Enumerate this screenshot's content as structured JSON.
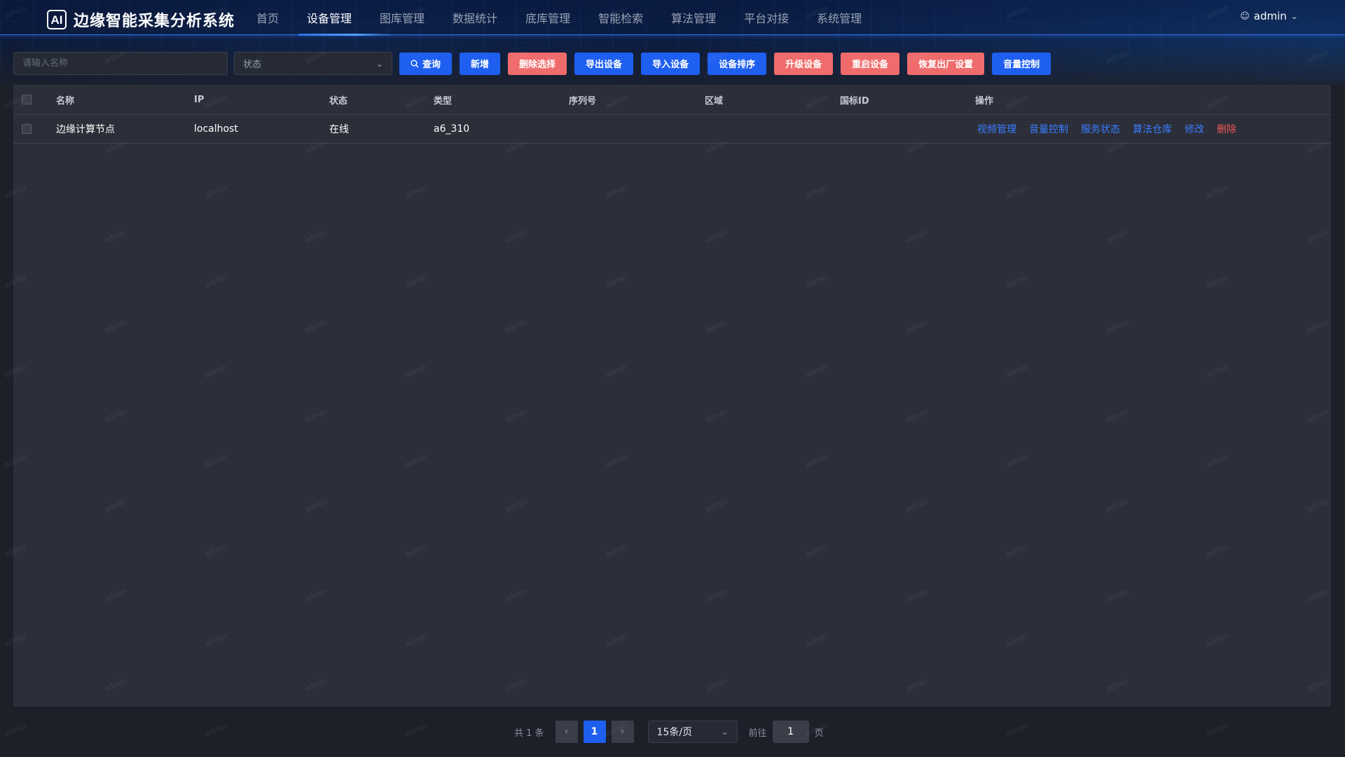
{
  "app": {
    "logo_text": "AI",
    "title": "边缘智能采集分析系统"
  },
  "nav": {
    "items": [
      {
        "label": "首页",
        "active": false
      },
      {
        "label": "设备管理",
        "active": true
      },
      {
        "label": "图库管理",
        "active": false
      },
      {
        "label": "数据统计",
        "active": false
      },
      {
        "label": "底库管理",
        "active": false
      },
      {
        "label": "智能检索",
        "active": false
      },
      {
        "label": "算法管理",
        "active": false
      },
      {
        "label": "平台对接",
        "active": false
      },
      {
        "label": "系统管理",
        "active": false
      }
    ]
  },
  "user": {
    "name": "admin",
    "icon": "user-icon"
  },
  "toolbar": {
    "search_placeholder": "请输入名称",
    "search_value": "",
    "status_select_placeholder": "状态",
    "buttons": {
      "query": "查询",
      "add": "新增",
      "delete_selected": "删除选择",
      "export": "导出设备",
      "import": "导入设备",
      "sort": "设备排序",
      "upgrade": "升级设备",
      "restart": "重启设备",
      "factory_reset": "恢复出厂设置",
      "volume": "音量控制"
    }
  },
  "table": {
    "columns": {
      "name": "名称",
      "ip": "IP",
      "status": "状态",
      "type": "类型",
      "serial": "序列号",
      "region": "区域",
      "gb_id": "国标ID",
      "ops": "操作"
    },
    "rows": [
      {
        "name": "边缘计算节点",
        "ip": "localhost",
        "status": "在线",
        "type": "a6_310",
        "serial": "",
        "region": "",
        "gb_id": "",
        "ops": {
          "video": "视频管理",
          "volume": "音量控制",
          "service": "服务状态",
          "algorithm": "算法仓库",
          "edit": "修改",
          "delete": "删除"
        }
      }
    ]
  },
  "pagination": {
    "total_text": "共 1 条",
    "current_page": "1",
    "page_size": "15条/页",
    "goto_prefix": "前往",
    "goto_value": "1",
    "goto_suffix": "页"
  },
  "watermark_text": "admin",
  "colors": {
    "primary": "#1e5ff0",
    "danger": "#f06b6b",
    "link": "#3a7cff",
    "bg": "#1d2029",
    "panel": "#2c2f39"
  }
}
